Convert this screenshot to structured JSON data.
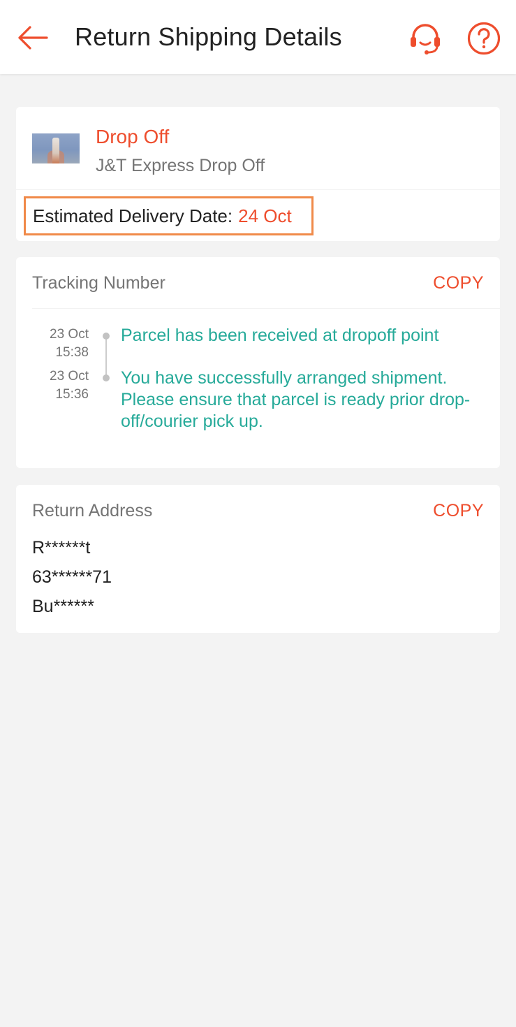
{
  "header": {
    "title": "Return Shipping Details",
    "back_icon": "arrow-left-icon",
    "support_icon": "headset-icon",
    "help_icon": "question-circle-icon",
    "accent_color": "#ee4d2d"
  },
  "dropoff": {
    "method": "Drop Off",
    "carrier": "J&T Express Drop Off",
    "eta_label": "Estimated Delivery Date:",
    "eta_value": "24 Oct"
  },
  "tracking": {
    "label": "Tracking Number",
    "copy_label": "COPY",
    "events": [
      {
        "date": "23 Oct",
        "time": "15:38",
        "text": "Parcel has been received at dropoff point"
      },
      {
        "date": "23 Oct",
        "time": "15:36",
        "text": "You have successfully arranged shipment. Please ensure that parcel is ready prior drop-off/courier pick up."
      }
    ],
    "status_color": "#26aa99"
  },
  "return_address": {
    "label": "Return Address",
    "copy_label": "COPY",
    "lines": [
      "R******t",
      "63******71",
      "Bu******"
    ]
  }
}
